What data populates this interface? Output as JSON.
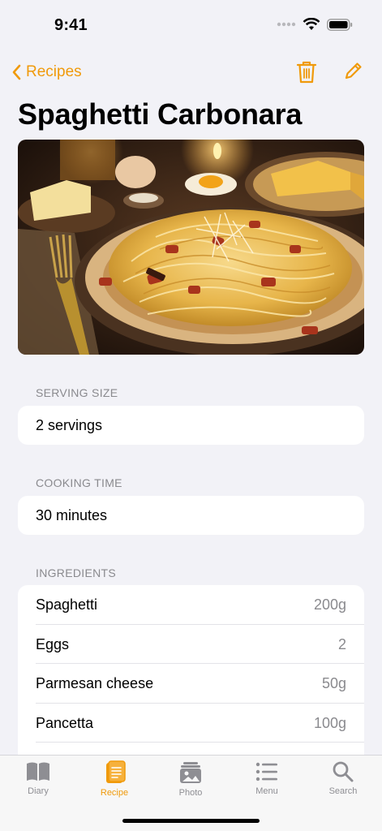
{
  "status": {
    "time": "9:41"
  },
  "nav": {
    "back_label": "Recipes"
  },
  "title": "Spaghetti Carbonara",
  "sections": {
    "serving": {
      "header": "SERVING SIZE",
      "value": "2 servings"
    },
    "cooking": {
      "header": "COOKING TIME",
      "value": "30 minutes"
    },
    "ingredients": {
      "header": "INGREDIENTS",
      "items": [
        {
          "name": "Spaghetti",
          "qty": "200g"
        },
        {
          "name": "Eggs",
          "qty": "2"
        },
        {
          "name": "Parmesan cheese",
          "qty": "50g"
        },
        {
          "name": "Pancetta",
          "qty": "100g"
        }
      ]
    }
  },
  "tabs": [
    {
      "label": "Diary",
      "icon": "book-icon"
    },
    {
      "label": "Recipe",
      "icon": "recipe-icon"
    },
    {
      "label": "Photo",
      "icon": "photo-icon"
    },
    {
      "label": "Menu",
      "icon": "list-icon"
    },
    {
      "label": "Search",
      "icon": "search-icon"
    }
  ],
  "colors": {
    "accent": "#f09a0b",
    "background": "#f2f2f7",
    "secondary_text": "#8a8a8e"
  }
}
